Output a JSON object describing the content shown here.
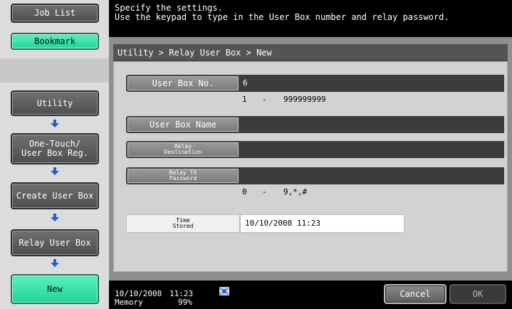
{
  "sidebar": {
    "job_list": "Job List",
    "bookmark": "Bookmark",
    "utility": "Utility",
    "one_touch": "One-Touch/\nUser Box Reg.",
    "create_user_box": "Create User Box",
    "relay_user_box": "Relay User Box",
    "new": "New"
  },
  "message": {
    "line1": "Specify the settings.",
    "line2": "Use the keypad to type in the User Box number and relay password."
  },
  "breadcrumb": "Utility > Relay User Box > New",
  "fields": {
    "user_box_no_label": "User Box No.",
    "user_box_no_value": "6",
    "user_box_no_range_min": "1",
    "user_box_no_range_dash": "-",
    "user_box_no_range_max": "999999999",
    "user_box_name_label": "User Box Name",
    "user_box_name_value": "",
    "relay_destination_label": "Relay\nDestination",
    "relay_destination_value": "",
    "relay_tx_password_label": "Relay TX\nPassword",
    "relay_tx_password_value": "",
    "password_range_min": "0",
    "password_range_dash": "-",
    "password_range_chars": "9,*,#",
    "time_stored_label": "Time\nStored",
    "time_stored_value": "10/10/2008   11:23"
  },
  "footer": {
    "date": "10/10/2008",
    "time": "11:23",
    "memory_label": "Memory",
    "memory_value": "99%",
    "cancel": "Cancel",
    "ok": "OK",
    "status_icon": "network-icon"
  },
  "colors": {
    "accent_green": "#1ed598",
    "panel_gray": "#8f8f8f",
    "field_dark": "#3c3c3c"
  }
}
